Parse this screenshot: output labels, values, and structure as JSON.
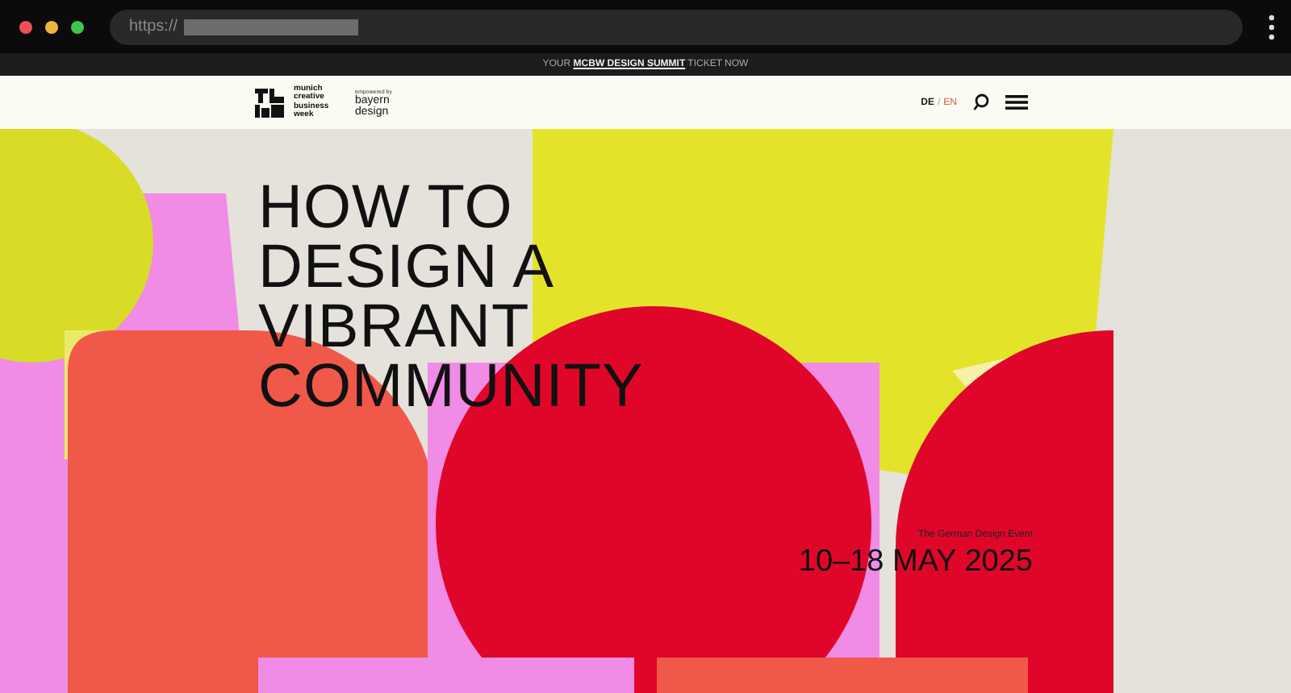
{
  "browser": {
    "url_prefix": "https://"
  },
  "banner": {
    "before": "YOUR",
    "link": "MCBW DESIGN SUMMIT",
    "after": "TICKET NOW"
  },
  "header": {
    "logo_text": "munich creative business week",
    "partner_caption": "empowered by",
    "partner_name": "bayern design",
    "languages": [
      {
        "label": "DE",
        "selected": true
      },
      {
        "label": "EN",
        "selected": false
      }
    ],
    "separator": "/"
  },
  "hero": {
    "title_lines": [
      "HOW TO",
      "DESIGN A",
      "VIBRANT",
      "COMMUNITY"
    ],
    "subtitle": "The German Design Event",
    "dates": "10–18 MAY 2025"
  }
}
